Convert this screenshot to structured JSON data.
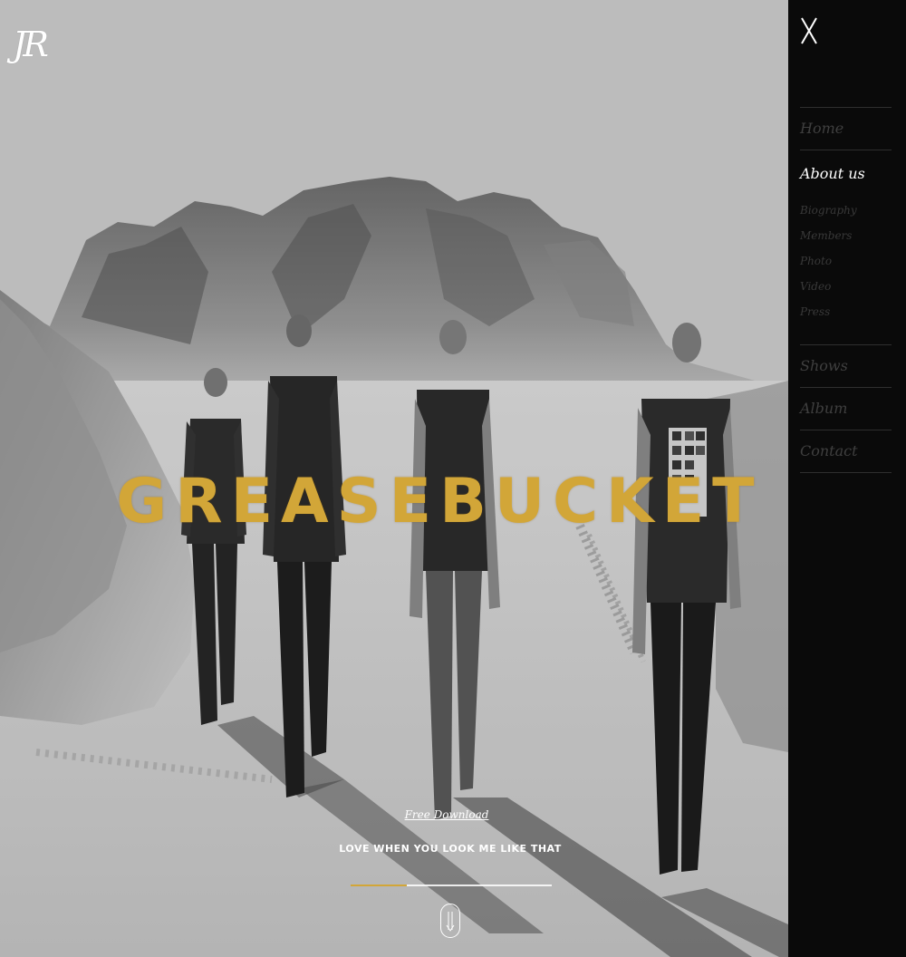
{
  "logo": {
    "text": "JR"
  },
  "hero": {
    "band_name": "GREASEBUCKET",
    "free_download_label": "Free Download",
    "song_title": "LOVE WHEN YOU LOOK ME LIKE THAT",
    "progress": 0.28,
    "scroll_icon": "scroll-down-arrow-icon"
  },
  "side_menu": {
    "close_label": "X",
    "items": [
      {
        "label": "Home",
        "active": false
      },
      {
        "label": "About us",
        "active": true,
        "children": [
          "Biography",
          "Members",
          "Photo",
          "Video",
          "Press"
        ]
      },
      {
        "label": "Shows",
        "active": false
      },
      {
        "label": "Album",
        "active": false
      },
      {
        "label": "Contact",
        "active": false
      }
    ]
  },
  "colors": {
    "accent_gold": "#d2a638",
    "menu_background": "#0a0a0a",
    "menu_text_inactive": "#3f3f3f",
    "menu_text_active": "#ffffff"
  }
}
